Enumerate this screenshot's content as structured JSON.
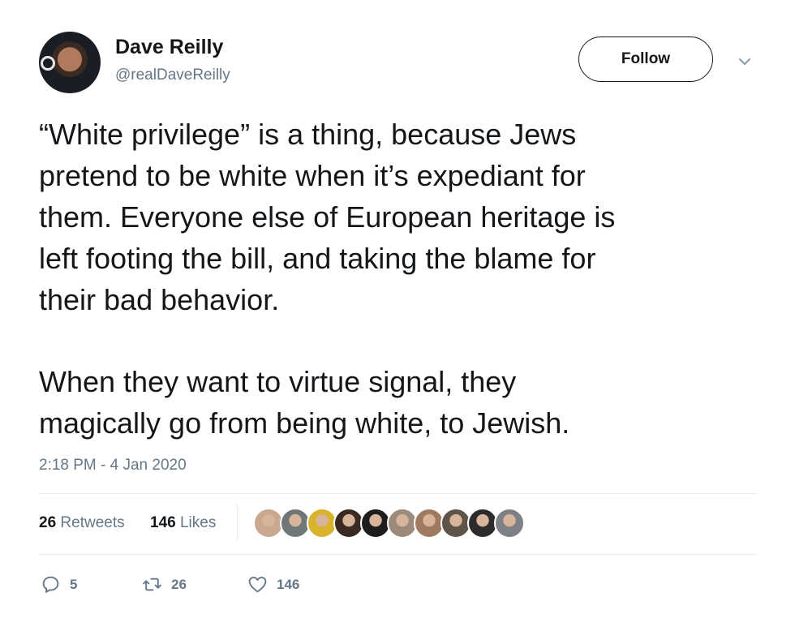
{
  "author": {
    "name": "Dave Reilly",
    "handle": "@realDaveReilly"
  },
  "follow_label": "Follow",
  "tweet": {
    "paragraph1_lines": [
      "“White privilege” is a thing, because Jews",
      "pretend to be white when it’s expediant for",
      "them. Everyone else of European heritage is",
      "left footing the bill, and taking the blame for",
      "their bad behavior."
    ],
    "paragraph2_lines": [
      "When they want to virtue signal, they",
      "magically go from being white, to Jewish."
    ],
    "timestamp": "2:18 PM - 4 Jan 2020"
  },
  "stats": {
    "retweets_count": "26",
    "retweets_label": "Retweets",
    "likes_count": "146",
    "likes_label": "Likes"
  },
  "liker_avatars": [
    {
      "color": "#c9a88f"
    },
    {
      "color": "#6f7778"
    },
    {
      "color": "#d9b32b"
    },
    {
      "color": "#3a2a22"
    },
    {
      "color": "#1d1d1d"
    },
    {
      "color": "#9c8a7c"
    },
    {
      "color": "#a07a60"
    },
    {
      "color": "#5e5448"
    },
    {
      "color": "#2c2a2a"
    },
    {
      "color": "#7d8186"
    }
  ],
  "actions": {
    "reply_count": "5",
    "retweet_count": "26",
    "like_count": "146"
  },
  "icons": [
    "chevron-down-icon",
    "reply-icon",
    "retweet-icon",
    "heart-icon"
  ]
}
